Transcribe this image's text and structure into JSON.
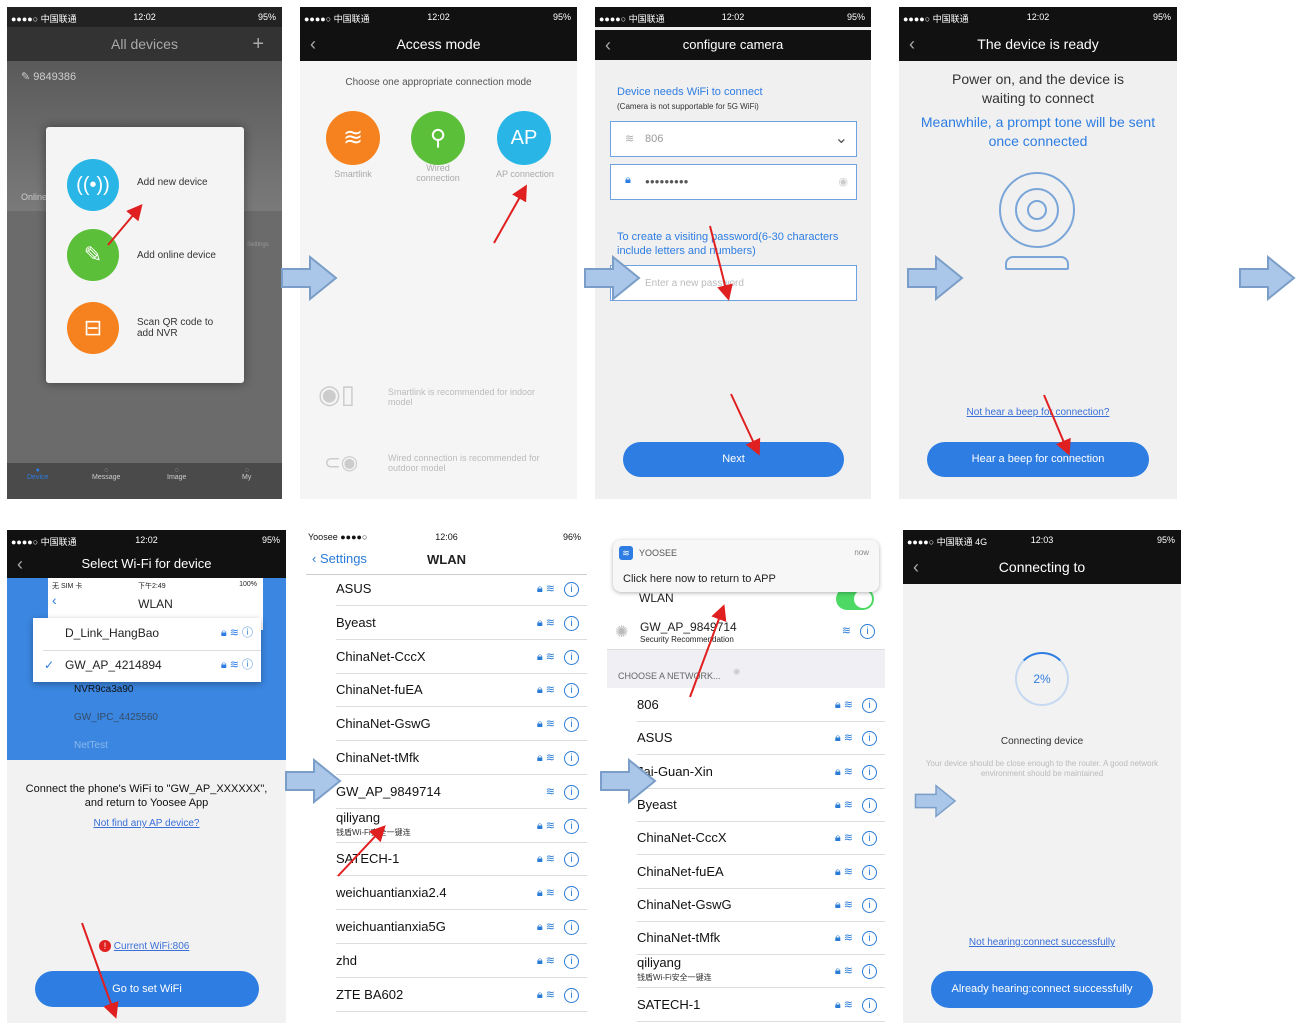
{
  "screens": {
    "s1": {
      "carrier": "●●●●○ 中国联通 ",
      "time": "12:02",
      "battery": "95%",
      "title": "All devices",
      "plus": "+",
      "device_id": "9849386",
      "online": "Online",
      "menu": [
        "Add new device",
        "Add online device",
        "Scan QR code to add NVR"
      ],
      "tabs": [
        "Device",
        "Message",
        "Image",
        "My"
      ],
      "settings": "Settings"
    },
    "s2": {
      "carrier": "●●●●○ 中国联通 ",
      "time": "12:02",
      "battery": "95%",
      "title": "Access mode",
      "prompt": "Choose one appropriate connection mode",
      "modes": [
        "Smartlink",
        "Wired connection",
        "AP connection"
      ],
      "ap": "AP",
      "note1": "Smartlink is recommended for indoor model",
      "note2": "Wired connection is recommended for outdoor model"
    },
    "s3": {
      "carrier": "●●●●○ 中国联通 ",
      "time": "12:02",
      "battery": "95%",
      "title": "configure camera",
      "needs": "Device needs WiFi to connect",
      "needs_sub": "(Camera is not supportable for 5G WiFi)",
      "wifi": "806",
      "password": "●●●●●●●●●",
      "create": "To create a visiting password(6-30 characters include letters and numbers)",
      "placeholder": "Enter a new password",
      "next": "Next"
    },
    "s4": {
      "carrier": "●●●●○ 中国联通 ",
      "time": "12:02",
      "battery": "95%",
      "title": "The device is ready",
      "line1": "Power on, and the device is waiting to connect",
      "line2": "Meanwhile, a prompt tone will be sent once connected",
      "link": "Not hear a beep for connection?",
      "button": "Hear a beep for connection"
    },
    "s5": {
      "carrier": "●●●●○ 中国联通 ",
      "time": "12:02",
      "battery": "95%",
      "title": "Select Wi-Fi for device",
      "inner_status": "无 SIM 卡",
      "inner_time": "下午2:49",
      "inner_batt": "100%",
      "inner_title": "WLAN",
      "networks": [
        "D_Link_HangBao",
        "GW_AP_4214894",
        "NVR9ca3a90",
        "GW_IPC_4425560",
        "NetTest"
      ],
      "instr": "Connect the phone's WiFi to \"GW_AP_XXXXXX\", and return to  Yoosee  App",
      "link": "Not find any AP device?",
      "current": "Current WiFi:806",
      "button": "Go to set WiFi"
    },
    "s6": {
      "carrier": "Yoosee ●●●●○ ",
      "time": "12:06",
      "battery": "96%",
      "back": "Settings",
      "title": "WLAN",
      "networks": [
        "ASUS",
        "Byeast",
        "ChinaNet-CccX",
        "ChinaNet-fuEA",
        "ChinaNet-GswG",
        "ChinaNet-tMfk",
        "GW_AP_9849714",
        "qiliyang",
        "SATECH-1",
        "weichuantianxia2.4",
        "weichuantianxia5G",
        "zhd",
        "ZTE BA602"
      ],
      "qili_sub": "钱盾Wi-Fi安全一键连"
    },
    "s7": {
      "app": "YOOSEE",
      "now": "now",
      "notice": "Click here now to return to APP",
      "wlan": "WLAN",
      "current": "GW_AP_9849714",
      "current_sub": "Security Recommendation",
      "choose": "CHOOSE A NETWORK...",
      "networks": [
        "806",
        "ASUS",
        "Jai-Guan-Xin",
        "Byeast",
        "ChinaNet-CccX",
        "ChinaNet-fuEA",
        "ChinaNet-GswG",
        "ChinaNet-tMfk",
        "qiliyang",
        "SATECH-1"
      ],
      "qili_sub": "钱盾Wi-Fi安全一键连"
    },
    "s8": {
      "carrier": "●●●●○ 中国联通  4G",
      "time": "12:03",
      "battery": "95%",
      "title": "Connecting to",
      "progress": "2%",
      "connecting": "Connecting device",
      "hint": "Your device should be close enough to the router. A good network environment should be maintained",
      "link": "Not hearing:connect successfully",
      "button": "Already hearing:connect successfully"
    }
  },
  "colors": {
    "blue": "#2e7de2",
    "orange": "#f5821f",
    "green": "#5cbf3a",
    "cyan": "#29b6e6",
    "arrow": "#aac6e8",
    "red": "#e02020"
  }
}
